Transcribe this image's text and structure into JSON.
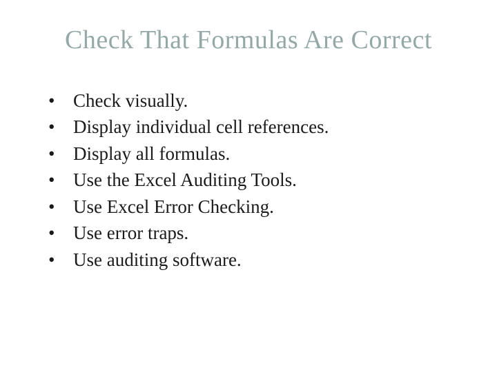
{
  "slide": {
    "title": "Check That Formulas Are Correct",
    "bullets": [
      "Check visually.",
      "Display individual cell references.",
      "Display all formulas.",
      "Use the Excel Auditing Tools.",
      "Use Excel Error Checking.",
      "Use error traps.",
      "Use auditing software."
    ]
  }
}
